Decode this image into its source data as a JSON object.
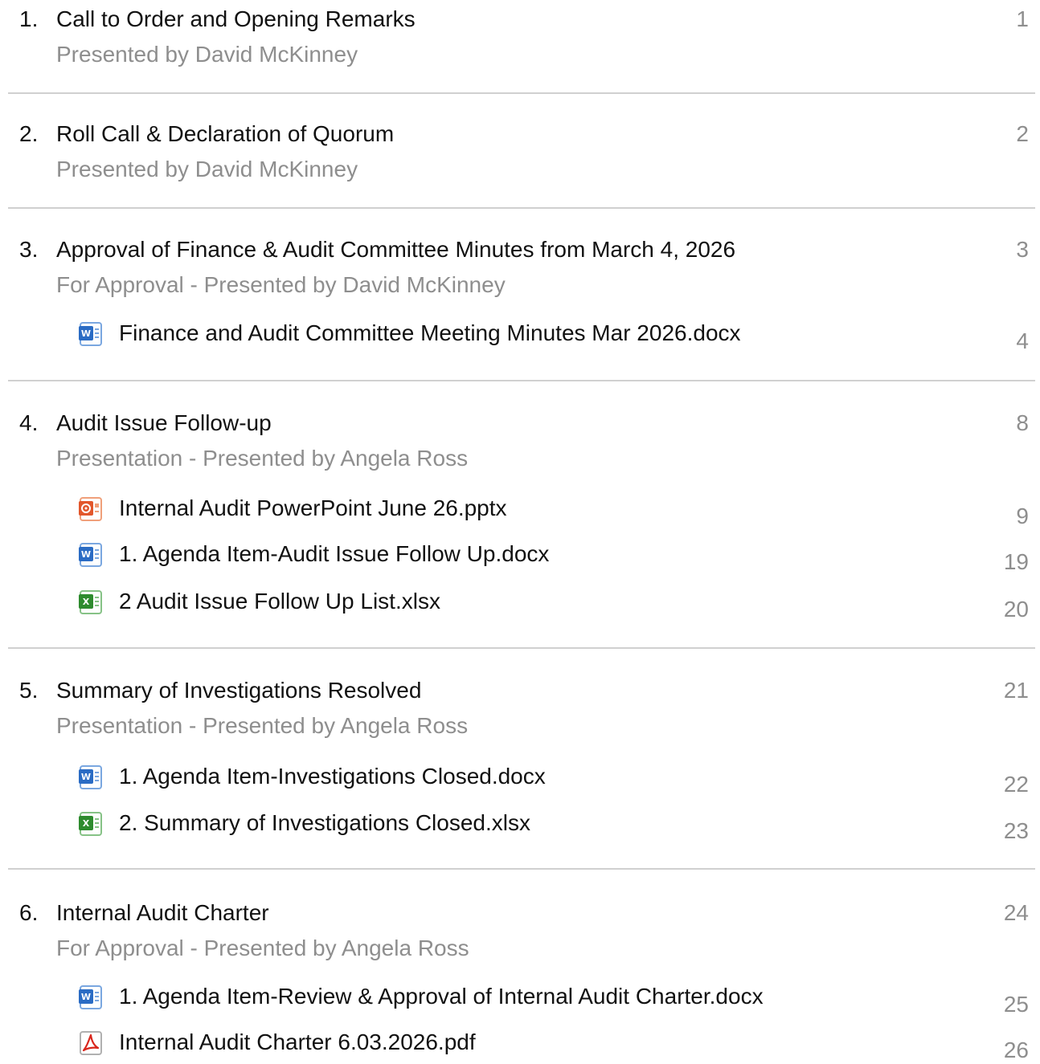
{
  "items": [
    {
      "number": "1.",
      "title": "Call to Order and Opening Remarks",
      "subtitle": "Presented by David McKinney",
      "page": "1",
      "attachments": []
    },
    {
      "number": "2.",
      "title": "Roll Call & Declaration of Quorum",
      "subtitle": "Presented by David McKinney",
      "page": "2",
      "attachments": []
    },
    {
      "number": "3.",
      "title": "Approval of Finance & Audit Committee Minutes from March 4, 2026",
      "subtitle": "For Approval - Presented by David McKinney",
      "page": "3",
      "attachments": [
        {
          "name": "Finance and Audit Committee Meeting Minutes Mar 2026.docx",
          "icon": "word-doc-icon",
          "page": "4"
        }
      ]
    },
    {
      "number": "4.",
      "title": "Audit Issue Follow-up",
      "subtitle": "Presentation - Presented by Angela Ross",
      "page": "8",
      "attachments": [
        {
          "name": "Internal Audit PowerPoint June 26.pptx",
          "icon": "powerpoint-doc-icon",
          "page": "9"
        },
        {
          "name": "1. Agenda Item-Audit Issue Follow Up.docx",
          "icon": "word-doc-icon",
          "page": "19"
        },
        {
          "name": "2 Audit Issue Follow Up List.xlsx",
          "icon": "excel-doc-icon",
          "page": "20"
        }
      ]
    },
    {
      "number": "5.",
      "title": "Summary of Investigations Resolved",
      "subtitle": "Presentation - Presented by Angela Ross",
      "page": "21",
      "attachments": [
        {
          "name": "1. Agenda Item-Investigations Closed.docx",
          "icon": "word-doc-icon",
          "page": "22"
        },
        {
          "name": "2. Summary of Investigations Closed.xlsx",
          "icon": "excel-doc-icon",
          "page": "23"
        }
      ]
    },
    {
      "number": "6.",
      "title": "Internal Audit Charter",
      "subtitle": "For Approval - Presented by Angela Ross",
      "page": "24",
      "attachments": [
        {
          "name": "1. Agenda Item-Review & Approval of Internal Audit Charter.docx",
          "icon": "word-doc-icon",
          "page": "25"
        },
        {
          "name": "Internal Audit Charter 6.03.2026.pdf",
          "icon": "pdf-doc-icon",
          "page": "26"
        }
      ]
    }
  ],
  "colors": {
    "text": "#111111",
    "muted": "#8e8e8e",
    "divider": "#d0d0d0",
    "word": "#2b6cc4",
    "excel": "#2e8b2e",
    "powerpoint": "#e2572c",
    "pdf": "#d9261c"
  }
}
